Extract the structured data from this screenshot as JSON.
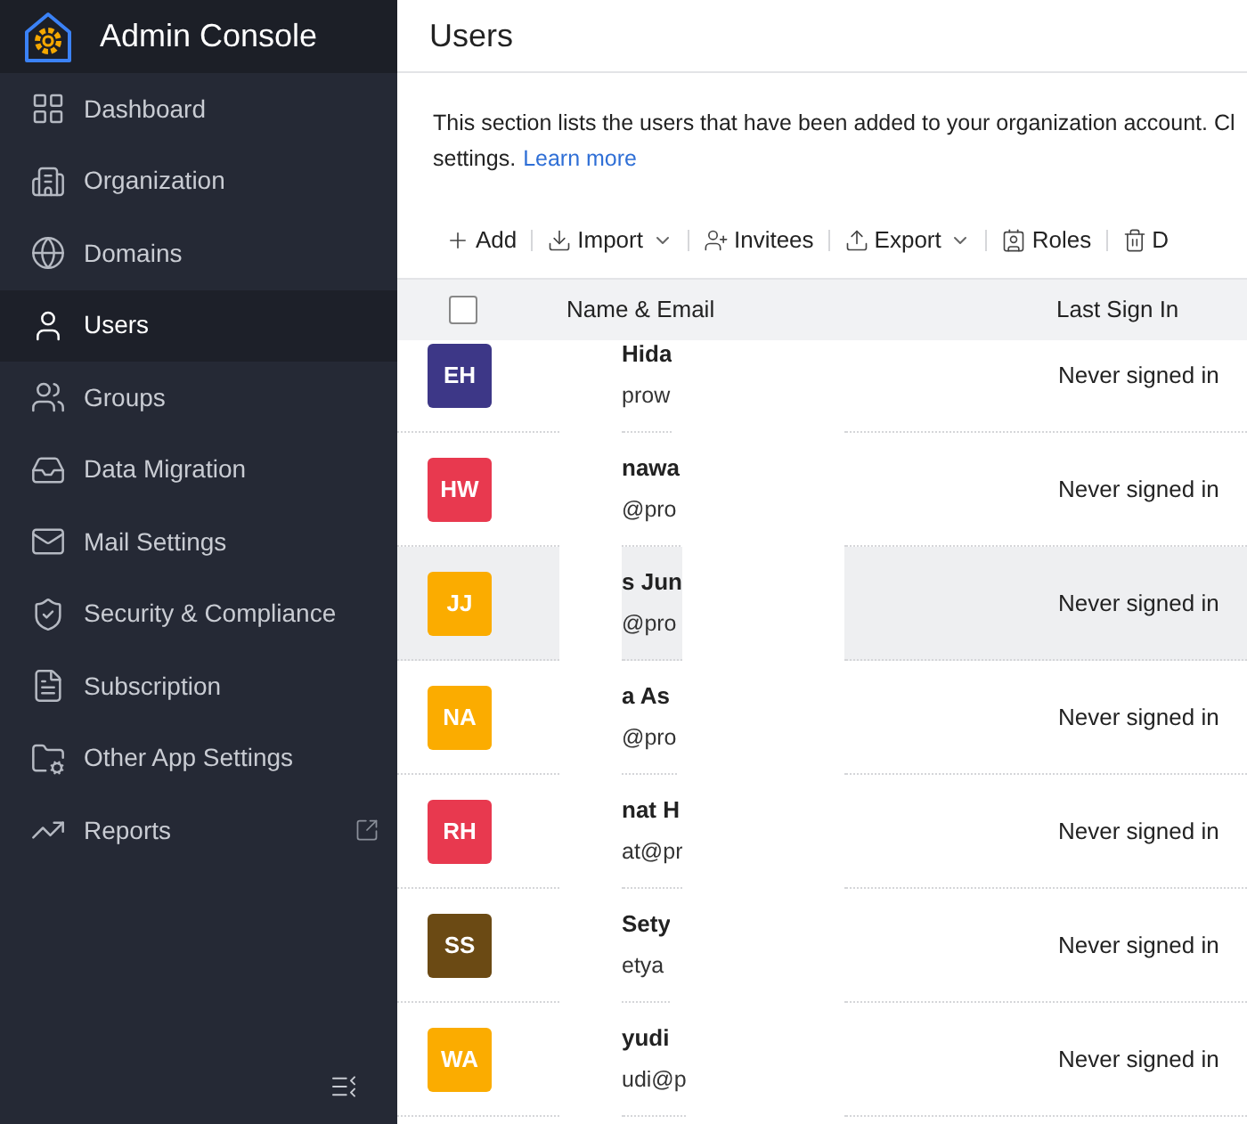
{
  "app": {
    "title": "Admin Console"
  },
  "sidebar": {
    "items": [
      {
        "label": "Dashboard",
        "selected": false
      },
      {
        "label": "Organization",
        "selected": false
      },
      {
        "label": "Domains",
        "selected": false
      },
      {
        "label": "Users",
        "selected": true
      },
      {
        "label": "Groups",
        "selected": false
      },
      {
        "label": "Data Migration",
        "selected": false
      },
      {
        "label": "Mail Settings",
        "selected": false
      },
      {
        "label": "Security & Compliance",
        "selected": false
      },
      {
        "label": "Subscription",
        "selected": false
      },
      {
        "label": "Other App Settings",
        "selected": false
      },
      {
        "label": "Reports",
        "selected": false,
        "external": true
      }
    ]
  },
  "page": {
    "title": "Users",
    "description": [
      "This section lists the users that have been added to your organization account. Cl",
      "settings."
    ],
    "link": "Learn more"
  },
  "toolbar": [
    {
      "label": "Add",
      "dropdown": false
    },
    {
      "label": "Import",
      "dropdown": true
    },
    {
      "label": "Invitees",
      "dropdown": false
    },
    {
      "label": "Export",
      "dropdown": true
    },
    {
      "label": "Roles",
      "dropdown": false
    },
    {
      "label": "D",
      "dropdown": false
    }
  ],
  "table": {
    "columns": [
      "Name & Email",
      "Last Sign In"
    ],
    "all_checked": false,
    "rows": [
      {
        "initials": "EH",
        "color": "#3d3787",
        "name": "Hida",
        "email": "prow",
        "last_sign_in": "Never signed in",
        "hovered": false
      },
      {
        "initials": "HW",
        "color": "#e8394f",
        "name": "nawa",
        "email": "@pro",
        "last_sign_in": "Never signed in",
        "hovered": false
      },
      {
        "initials": "JJ",
        "color": "#fbac00",
        "name": "s Jun",
        "email": "@pro",
        "last_sign_in": "Never signed in",
        "hovered": true
      },
      {
        "initials": "NA",
        "color": "#fbac00",
        "name": "a As",
        "email": "@pro",
        "last_sign_in": "Never signed in",
        "hovered": false
      },
      {
        "initials": "RH",
        "color": "#e8394f",
        "name": "nat H",
        "email": "at@pr",
        "last_sign_in": "Never signed in",
        "hovered": false
      },
      {
        "initials": "SS",
        "color": "#6b4a14",
        "name": "Sety",
        "email": "etya",
        "last_sign_in": "Never signed in",
        "hovered": false
      },
      {
        "initials": "WA",
        "color": "#fbac00",
        "name": "yudi",
        "email": "udi@p",
        "last_sign_in": "Never signed in",
        "hovered": false
      }
    ]
  }
}
